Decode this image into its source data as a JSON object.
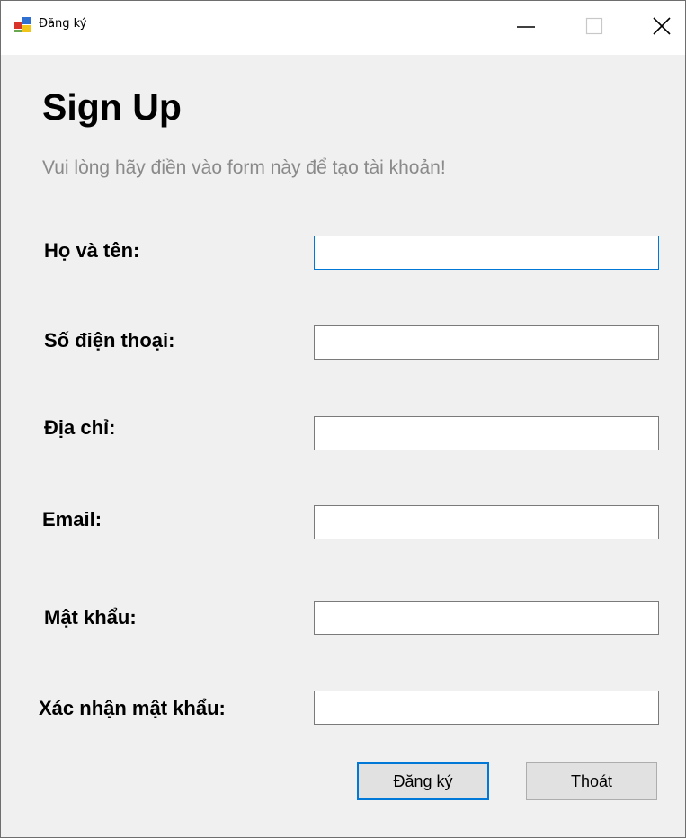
{
  "window": {
    "title": "Đăng ký",
    "icon": "winforms-app-icon",
    "controls": {
      "minimize_icon": "minimize-icon",
      "maximize_icon": "maximize-icon",
      "close_icon": "close-icon"
    }
  },
  "form": {
    "heading": "Sign Up",
    "subtitle": "Vui lòng hãy điền vào form này để tạo tài khoản!",
    "fields": [
      {
        "label": "Họ và tên:",
        "value": "",
        "focused": true
      },
      {
        "label": "Số điện thoại:",
        "value": ""
      },
      {
        "label": "Địa chỉ:",
        "value": ""
      },
      {
        "label": "Email:",
        "value": ""
      },
      {
        "label": "Mật khẩu:",
        "value": ""
      },
      {
        "label": "Xác nhận mật khẩu:",
        "value": ""
      }
    ],
    "buttons": {
      "submit_label": "Đăng ký",
      "exit_label": "Thoát"
    }
  },
  "colors": {
    "client_background": "#f0f0f0",
    "accent_focus": "#0078d7",
    "subtitle_text": "#8a8a8a",
    "button_background": "#e1e1e1"
  }
}
